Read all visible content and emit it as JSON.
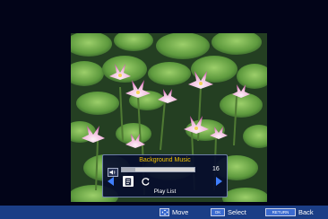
{
  "screen": {
    "background": "#020418",
    "photo": {
      "subject": "pink water lilies among lily pads"
    }
  },
  "music_panel": {
    "title": "Background Music",
    "title_color": "#f2c200",
    "volume": {
      "icon": "speaker-icon",
      "value": "16",
      "level_fraction": 0.18
    },
    "controls": {
      "prev_icon": "triangle-left-icon",
      "playlist_icon": "document-icon",
      "repeat_icon": "repeat-icon",
      "next_icon": "triangle-right-icon",
      "arrow_color": "#3f7fff"
    },
    "label": "Play List"
  },
  "bottom_bar": {
    "color": "#1b3e86",
    "move": {
      "key_icon": "four-arrows-icon",
      "label": "Move"
    },
    "select": {
      "key": "OK",
      "label": "Select"
    },
    "back": {
      "key": "RETURN",
      "label": "Back"
    }
  }
}
